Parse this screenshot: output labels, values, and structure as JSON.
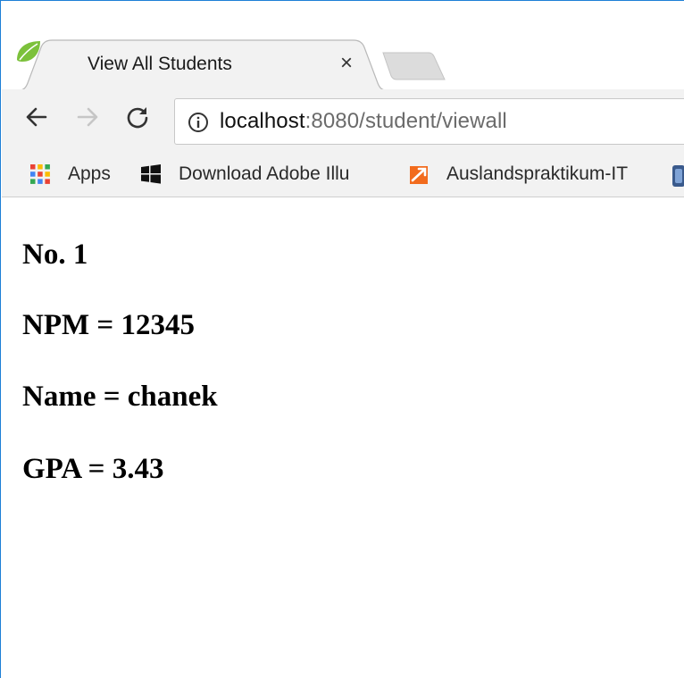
{
  "browser": {
    "tab": {
      "title": "View All Students",
      "close_glyph": "×",
      "favicon": "spring-leaf-icon"
    },
    "toolbar": {
      "back": "back-arrow-icon",
      "forward": "forward-arrow-icon",
      "reload": "reload-icon",
      "url_host": "localhost",
      "url_path": ":8080/student/viewall"
    },
    "bookmarks": [
      {
        "label": "Apps",
        "icon": "apps-grid-icon"
      },
      {
        "label": "Download Adobe Illu",
        "icon": "windows-logo-icon"
      },
      {
        "label": "Auslandspraktikum-IT",
        "icon": "orange-arrow-icon"
      }
    ]
  },
  "page": {
    "student_no": "No. 1",
    "npm": "NPM = 12345",
    "name": "Name = chanek",
    "gpa": "GPA = 3.43"
  },
  "colors": {
    "window_border": "#1e7fd6",
    "toolbar_bg": "#f2f2f2",
    "url_path": "#6b6b6b"
  }
}
